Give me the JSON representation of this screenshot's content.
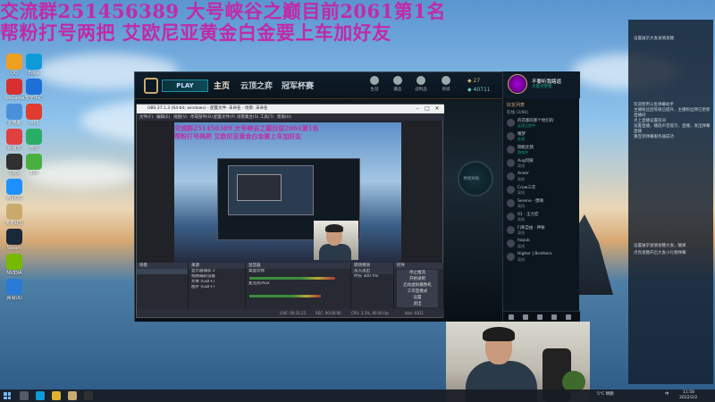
{
  "overlay": {
    "line1": "交流群251456389 大号峡谷之巅目前2061第1名",
    "line2": "帮粉打号两把 艾欧尼亚黄金白金要上车加好友"
  },
  "desktop_icons": [
    {
      "label": "QQ",
      "color": "#f0a020"
    },
    {
      "label": "WeGame",
      "color": "#d83030"
    },
    {
      "label": "此电脑",
      "color": "#4a90d8"
    },
    {
      "label": "网易云",
      "color": "#e04040"
    },
    {
      "label": "OBS",
      "color": "#303030"
    },
    {
      "label": "腾讯QQ",
      "color": "#1e90ff"
    },
    {
      "label": "英雄联盟",
      "color": "#c8aa6e"
    },
    {
      "label": "Steam",
      "color": "#1b2838"
    },
    {
      "label": "NVIDIA",
      "color": "#76b900"
    },
    {
      "label": "网易UU",
      "color": "#2a7ad8"
    },
    {
      "label": "Edge",
      "color": "#0f9bd7"
    },
    {
      "label": "安全中心",
      "color": "#1f6fd8"
    },
    {
      "label": "WPS",
      "color": "#e03c30"
    },
    {
      "label": "微信",
      "color": "#2aae67"
    },
    {
      "label": "360",
      "color": "#48b040"
    }
  ],
  "lol": {
    "play_label": "PLAY",
    "nav": [
      "主页",
      "云顶之弈",
      "冠军杯赛"
    ],
    "top_icons": [
      "生涯",
      "藏品",
      "战利品",
      "商城"
    ],
    "rp": "27",
    "be": "40711",
    "find_match": "寻找对局"
  },
  "social": {
    "name": "不要听我瞎逼",
    "status": "大佬点赞我",
    "friends_header": "好友列表",
    "online_count": "在线 (3/60)",
    "friends": [
      {
        "name": "的花都的那个他们的",
        "status": "云顶之弈中",
        "online": true
      },
      {
        "name": "耀梦",
        "status": "在线",
        "online": true
      },
      {
        "name": "御姐北我",
        "status": "游戏中",
        "online": true
      },
      {
        "name": "Aug何解",
        "status": "离线",
        "online": false
      },
      {
        "name": "Anzer",
        "status": "离线",
        "online": false
      },
      {
        "name": "Crow三年",
        "status": "离线",
        "online": false
      },
      {
        "name": "Serene · 傻啊",
        "status": "离线",
        "online": false
      },
      {
        "name": "01 · 王力宏",
        "status": "离线",
        "online": false
      },
      {
        "name": "Fj和自由 · 神秘",
        "status": "离线",
        "online": false
      },
      {
        "name": "hayuk",
        "status": "离线",
        "online": false
      },
      {
        "name": "Higher | Brothers",
        "status": "离线",
        "online": false
      }
    ]
  },
  "obs": {
    "title": "OBS 27.1.3 (64-bit, windows) - 配置文件: 未命名 - 场景: 未命名",
    "menu": [
      "文件(F)",
      "编辑(E)",
      "视图(V)",
      "停靠部件(D)",
      "配置文件(P)",
      "场景集合(S)",
      "工具(T)",
      "帮助(H)"
    ],
    "scenes_header": "场景",
    "sources_header": "来源",
    "sources": [
      "显示器捕获 2",
      "视频捕获设备",
      "文本 (GDI+)",
      "图片 (GDI+)"
    ],
    "mixer_header": "混音器",
    "mixer_tracks": [
      "桌面音频",
      "麦克风/Aux"
    ],
    "transitions_header": "转场特效",
    "transition_name": "淡入淡出",
    "duration_label": "时长",
    "duration_value": "300 ms",
    "controls_header": "控件",
    "controls": [
      "停止推流",
      "开始录制",
      "启动虚拟摄像机",
      "工作室模式",
      "设置",
      "退出"
    ],
    "status": [
      "LIVE: 00:31:25",
      "REC: 00:00:00",
      "CPU: 3.1%, 60.00 fps",
      "kb/s: 6021"
    ]
  },
  "chat_lines": [
    "设置展示大发发情发糖",
    "欢迎使用斗鱼弹幕助手",
    "主播粉丝团等级已提升，主播粉丝牌已更新",
    "直播间",
    "点上直播设置房间",
    "设置直播，播放声音提示，直播，发出弹幕",
    "直播",
    "重连到弹幕服务器成功",
    "设置展示发情发糖大发，糖果",
    "点亮发糖开启大发小礼物弹幕"
  ],
  "taskbar": {
    "tray_weather": "5°C 晴朗",
    "tray_lang": "中",
    "time": "11:58",
    "date": "2022/2/2"
  }
}
